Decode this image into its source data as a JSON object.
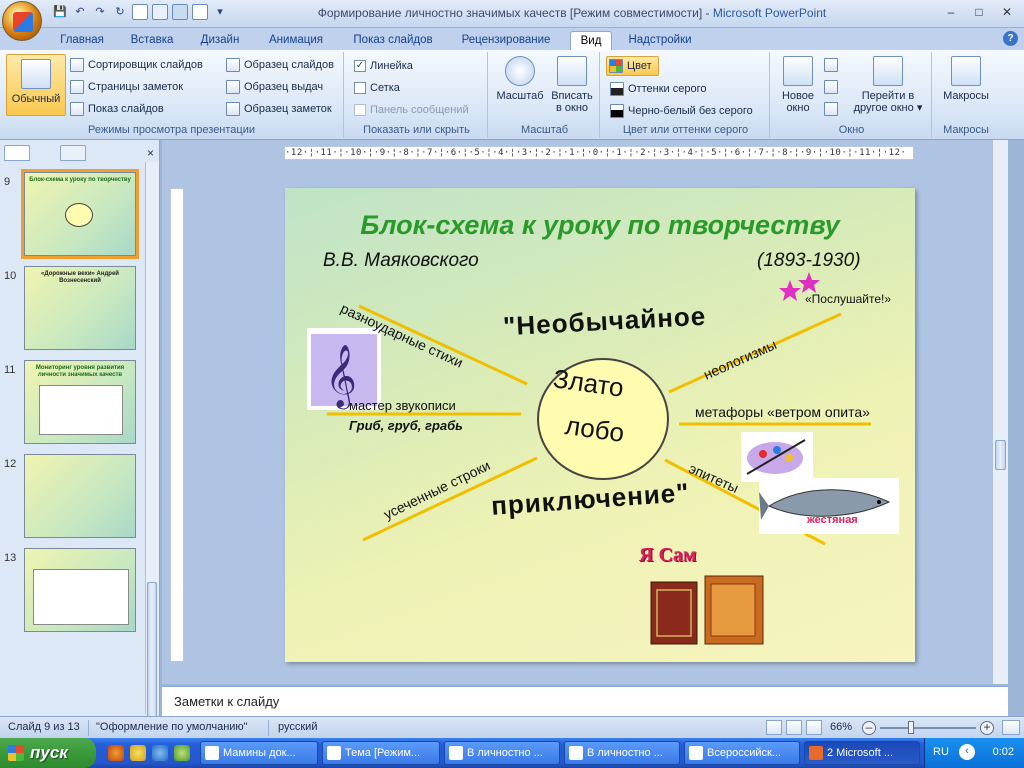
{
  "window": {
    "title": "Формирование личностно значимых качеств [Режим совместимости]",
    "title_sep": " - ",
    "app_name": "Microsoft PowerPoint",
    "min": "–",
    "max": "□",
    "close": "✕"
  },
  "qat": {
    "save_icon": "💾",
    "undo_icon": "↶",
    "redo_icon": "↷",
    "refresh_icon": "↻",
    "customize_icon": "▾"
  },
  "tabs": [
    "Главная",
    "Вставка",
    "Дизайн",
    "Анимация",
    "Показ слайдов",
    "Рецензирование",
    "Вид",
    "Надстройки"
  ],
  "help_icon": "?",
  "ribbon": {
    "views": {
      "normal": "Обычный",
      "sorter": "Сортировщик слайдов",
      "notes_page": "Страницы заметок",
      "slideshow": "Показ слайдов",
      "slide_master": "Образец слайдов",
      "handout_master": "Образец выдач",
      "notes_master": "Образец заметок",
      "label": "Режимы просмотра презентации"
    },
    "show": {
      "ruler": "Линейка",
      "ruler_check": "✓",
      "grid": "Сетка",
      "message_bar": "Панель сообщений",
      "label": "Показать или скрыть"
    },
    "zoom": {
      "zoom": "Масштаб",
      "fit": "Вписать",
      "fit2": "в окно",
      "label": "Масштаб"
    },
    "color": {
      "color": "Цвет",
      "grayscale": "Оттенки серого",
      "bw": "Черно-белый без серого",
      "label": "Цвет или оттенки серого"
    },
    "window": {
      "new": "Новое",
      "new2": "окно",
      "switch": "Перейти в",
      "switch2": "другое окно",
      "switch_arrow": "▾",
      "label": "Окно"
    },
    "macros": {
      "macros": "Макросы",
      "label": "Макросы"
    }
  },
  "left_panel": {
    "close": "×",
    "thumbs": [
      {
        "num": "9",
        "title": "Блок-схема к уроку по творчеству",
        "selected": true
      },
      {
        "num": "10",
        "title": "«Дорожные вехи» Андрей Вознесенский",
        "selected": false
      },
      {
        "num": "11",
        "title": "Мониторинг уровня развития личности значимых качеств",
        "selected": false
      },
      {
        "num": "12",
        "title": "",
        "selected": false
      },
      {
        "num": "13",
        "title": "",
        "selected": false
      }
    ]
  },
  "ruler": {
    "h": "·12·¦·11·¦·10·¦·9·¦·8·¦·7·¦·6·¦·5·¦·4·¦·3·¦·2·¦·1·¦·0·¦·1·¦·2·¦·3·¦·4·¦·5·¦·6·¦·7·¦·8·¦·9·¦·10·¦·11·¦·12·"
  },
  "slide": {
    "title": "Блок-схема к уроку по творчеству",
    "author": "В.В. Маяковского",
    "years": "(1893-1930)",
    "center_top": "Злато",
    "center_bottom": "лобо",
    "arc_top": "\"Необычайное",
    "arc_bottom": "приключение\"",
    "branch_raznoud": "разноударные стихи",
    "branch_master": "мастер звукописи",
    "branch_grib": "Гриб, груб, грабь",
    "branch_usech": "усеченные строки",
    "branch_neolog": "неологизмы",
    "branch_metafory": "метафоры  «ветром опита»",
    "branch_epitety": "эпитеты",
    "poslushaite": "«Послушайте!»",
    "zhestyanaya": "жестяная",
    "ya_sam": "Я Сам",
    "accent_line": "#f0c000",
    "title_color": "#2a9a2a"
  },
  "notes": {
    "placeholder": "Заметки к слайду"
  },
  "status": {
    "slide": "Слайд 9 из 13",
    "theme": "\"Оформление по умолчанию\"",
    "lang": "русский",
    "zoom": "66%",
    "zoom_level": 0.32,
    "minus": "–",
    "plus": "+"
  },
  "taskbar": {
    "start": "пуск",
    "tasks": [
      {
        "label": "Мамины док...",
        "active": false
      },
      {
        "label": "Тема [Режим...",
        "active": false
      },
      {
        "label": "В личностно ...",
        "active": false
      },
      {
        "label": "В личностно ...",
        "active": false
      },
      {
        "label": "Всероссийск...",
        "active": false
      },
      {
        "label": "2 Microsoft ...",
        "active": true
      }
    ],
    "lang": "RU",
    "arrow": "‹",
    "time": "0:02"
  }
}
